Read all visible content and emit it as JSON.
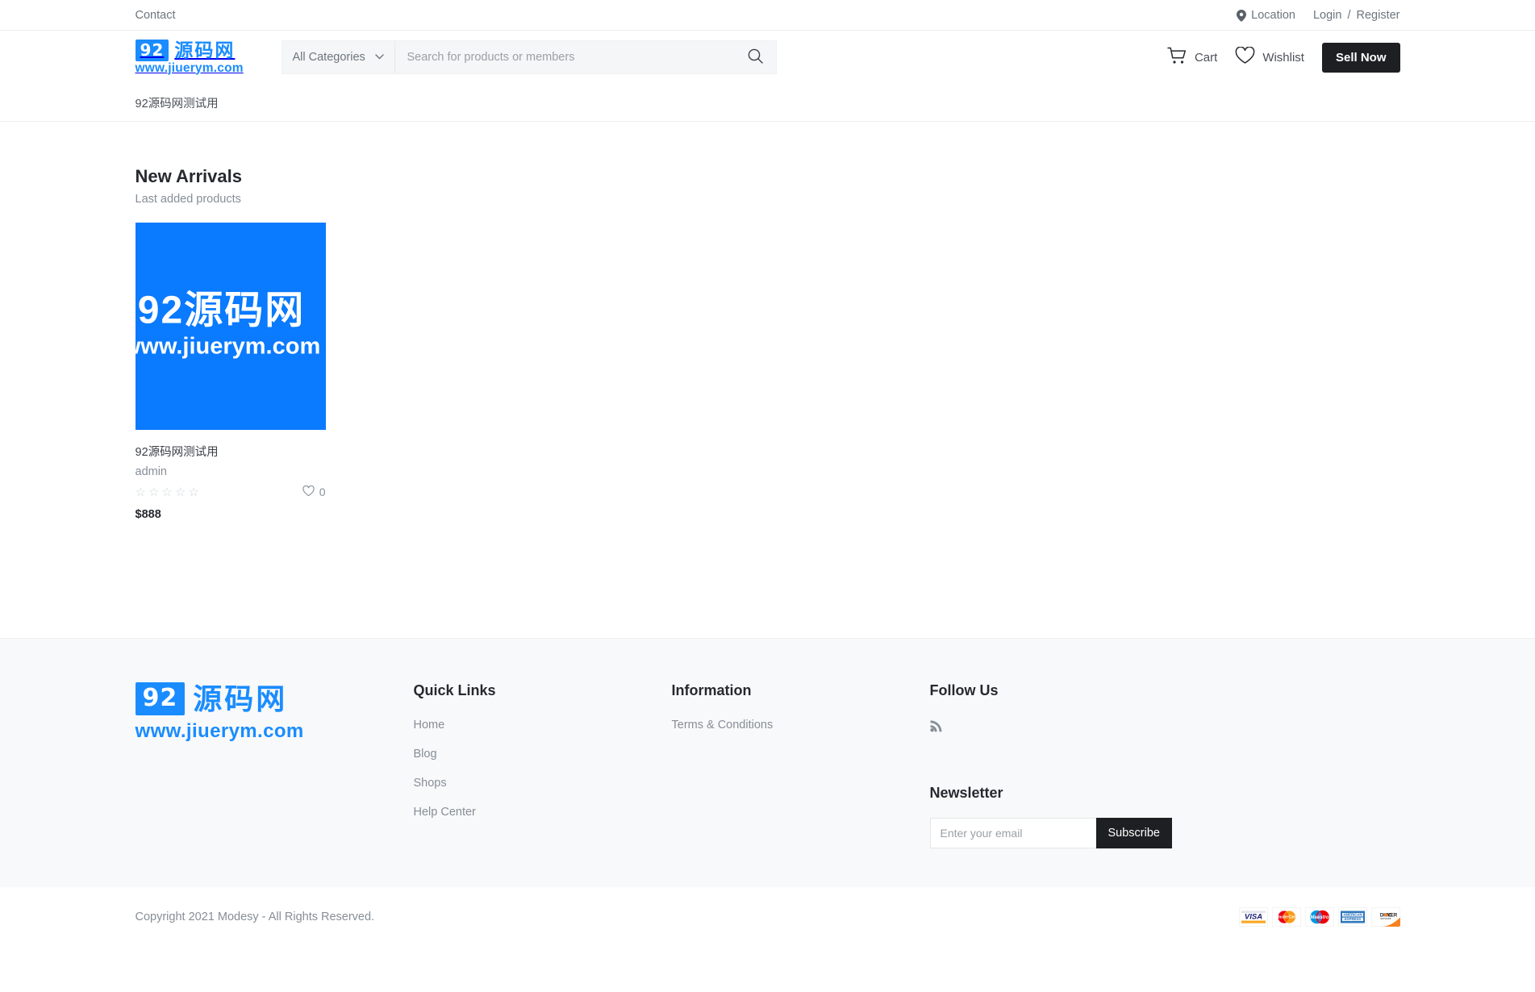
{
  "topbar": {
    "contact_label": "Contact",
    "location_label": "Location",
    "login_label": "Login",
    "separator": "/",
    "register_label": "Register"
  },
  "brand": {
    "badge": "92",
    "name_cn": "源码网",
    "url": "www.jiuerym.com"
  },
  "search": {
    "category_selected": "All Categories",
    "placeholder": "Search for products or members",
    "value": ""
  },
  "header": {
    "cart_label": "Cart",
    "wishlist_label": "Wishlist",
    "sell_now_label": "Sell Now"
  },
  "nav": {
    "items": [
      {
        "label": "92源码网测试用"
      }
    ]
  },
  "main": {
    "section_title": "New Arrivals",
    "section_subtitle": "Last added products",
    "products": [
      {
        "name": "92源码网测试用",
        "seller": "admin",
        "rating": 0,
        "stars": [
          "☆",
          "☆",
          "☆",
          "☆",
          "☆"
        ],
        "likes": "0",
        "price": "$888",
        "thumb_line1": "92源码网",
        "thumb_line2": "www.jiuerym.com",
        "thumb_color": "#0a7afe"
      }
    ]
  },
  "footer": {
    "quick_links": {
      "heading": "Quick Links",
      "items": [
        {
          "label": "Home"
        },
        {
          "label": "Blog"
        },
        {
          "label": "Shops"
        },
        {
          "label": "Help Center"
        }
      ]
    },
    "information": {
      "heading": "Information",
      "items": [
        {
          "label": "Terms & Conditions"
        }
      ]
    },
    "follow": {
      "heading": "Follow Us",
      "socials": [
        {
          "name": "rss-icon"
        }
      ]
    },
    "newsletter": {
      "heading": "Newsletter",
      "placeholder": "Enter your email",
      "value": "",
      "button_label": "Subscribe"
    }
  },
  "copyright": {
    "text": "Copyright 2021 Modesy - All Rights Reserved.",
    "payment_methods": [
      {
        "name": "visa",
        "label": "VISA"
      },
      {
        "name": "mastercard",
        "label": "MasterCard"
      },
      {
        "name": "maestro",
        "label": "Maestro"
      },
      {
        "name": "american-express",
        "label": "AMERICAN EXPRESS"
      },
      {
        "name": "discover",
        "label": "DISCOVER"
      }
    ]
  },
  "colors": {
    "brand_blue": "#1a8cff",
    "dark_button": "#1d1f22",
    "footer_bg": "#f8f9fa",
    "muted_text": "#868e96"
  }
}
